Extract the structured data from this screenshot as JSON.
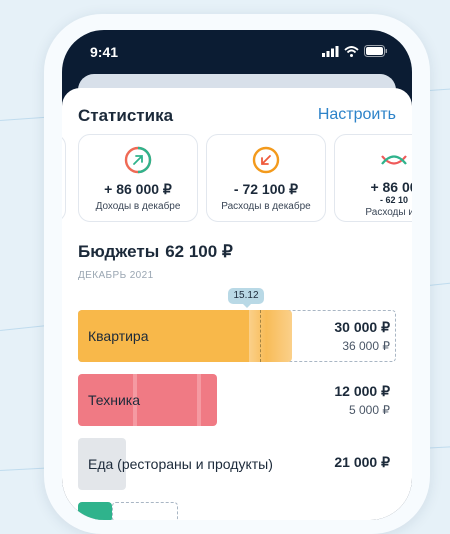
{
  "status": {
    "time": "9:41"
  },
  "header": {
    "title": "Статистика",
    "settings_label": "Настроить"
  },
  "cards": [
    {
      "amount": "+ 86 000 ₽",
      "caption": "Доходы в декабре",
      "icon": "arrow-up-right-circle-icon"
    },
    {
      "amount": "- 72 100 ₽",
      "caption": "Расходы в декабре",
      "icon": "arrow-down-left-circle-icon"
    },
    {
      "amount": "+ 86 00",
      "sub": "- 62 10",
      "caption": "Расходы и д",
      "icon": "crossing-lines-icon"
    }
  ],
  "budgets": {
    "title": "Бюджеты",
    "total": "62 100 ₽",
    "period": "ДЕКАБРЬ 2021",
    "today_marker": "15.12",
    "items": [
      {
        "name": "Квартира",
        "value": "30 000 ₽",
        "limit": "36 000 ₽",
        "color": "#f8b84a"
      },
      {
        "name": "Техника",
        "value": "12 000 ₽",
        "limit": "5 000 ₽",
        "color": "#f07a84"
      },
      {
        "name": "Еда (рестораны и продукты)",
        "value": "21 000 ₽",
        "color": "#e3e6ea"
      }
    ]
  },
  "colors": {
    "accent": "#2d83c9",
    "income": "#2fb38c",
    "expense": "#f39a1c"
  }
}
